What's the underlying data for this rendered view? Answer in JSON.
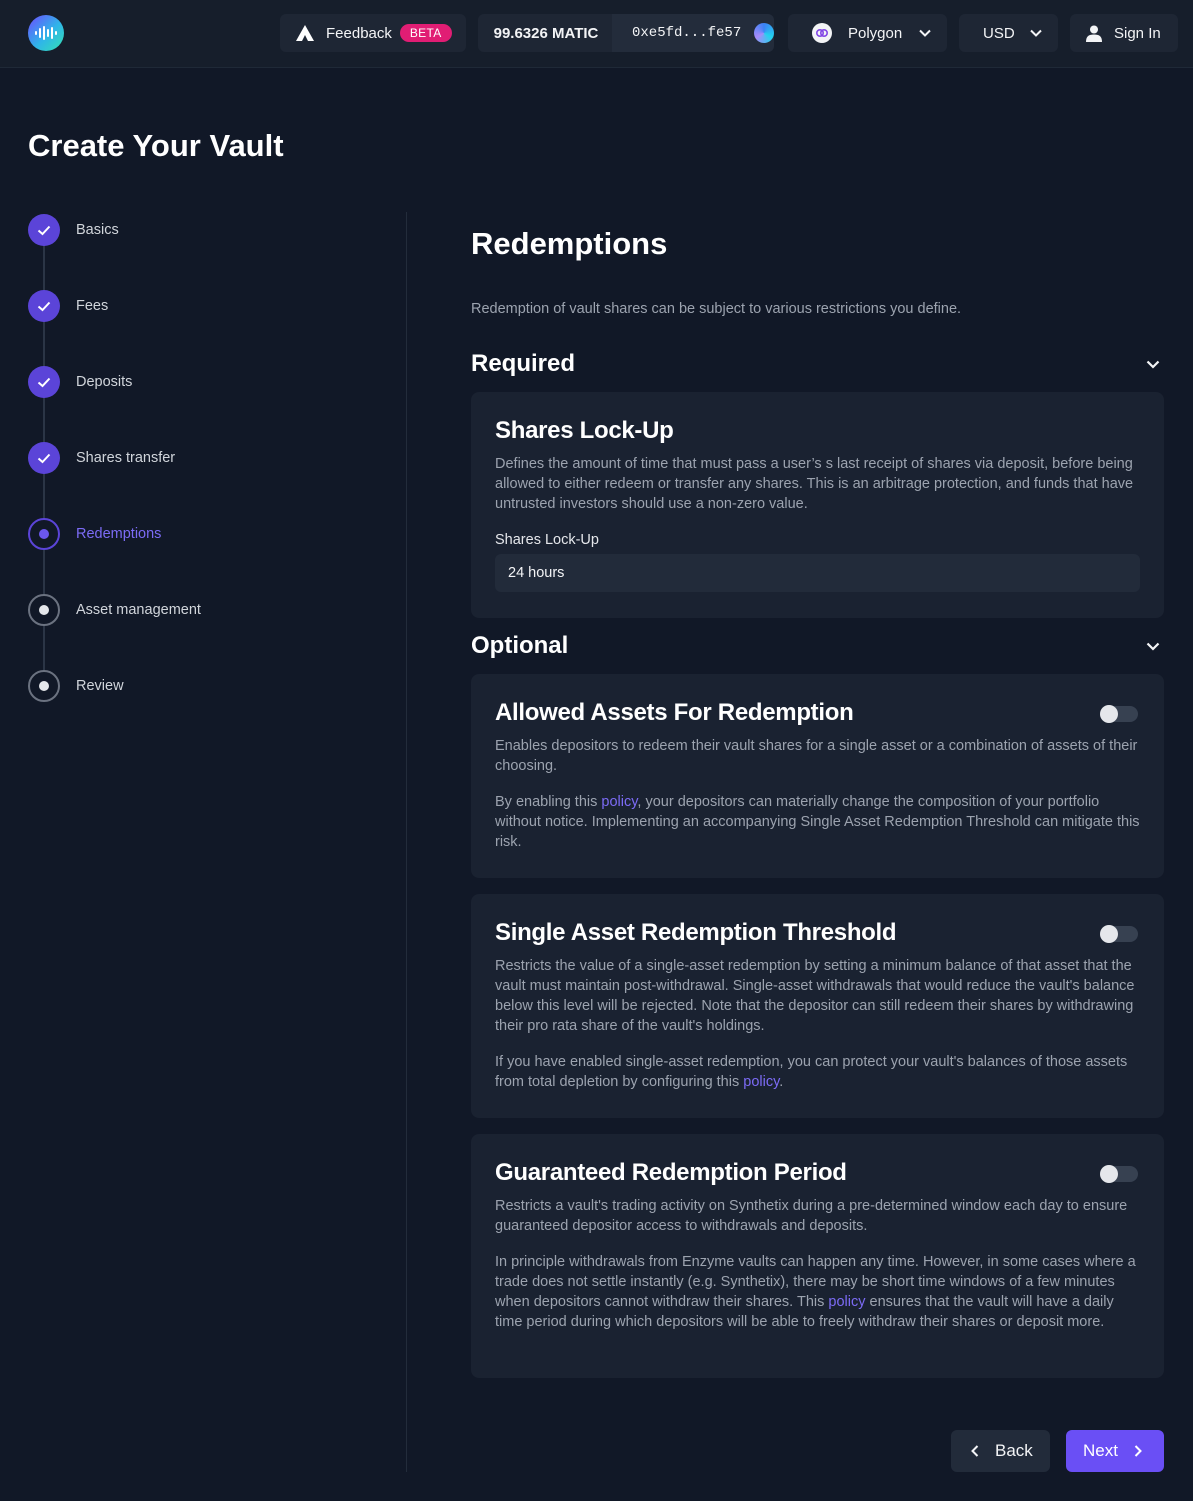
{
  "header": {
    "feedback_label": "Feedback",
    "feedback_badge": "BETA",
    "balance": "99.6326 MATIC",
    "address": "0xe5fd...fe57",
    "network": "Polygon",
    "currency": "USD",
    "signin_label": "Sign In"
  },
  "page_title": "Create Your Vault",
  "steps": [
    {
      "label": "Basics",
      "state": "done"
    },
    {
      "label": "Fees",
      "state": "done"
    },
    {
      "label": "Deposits",
      "state": "done"
    },
    {
      "label": "Shares transfer",
      "state": "done"
    },
    {
      "label": "Redemptions",
      "state": "current"
    },
    {
      "label": "Asset management",
      "state": "todo"
    },
    {
      "label": "Review",
      "state": "todo"
    }
  ],
  "main": {
    "title": "Redemptions",
    "description": "Redemption of vault shares can be subject to various restrictions you define.",
    "required": {
      "heading": "Required",
      "lockup": {
        "title": "Shares Lock-Up",
        "text": "Defines the amount of time that must pass a user’s s last receipt of shares via deposit, before being allowed to either redeem or transfer any shares. This is an arbitrage protection, and funds that have untrusted investors should use a non-zero value.",
        "field_label": "Shares Lock-Up",
        "field_value": "24 hours"
      }
    },
    "optional": {
      "heading": "Optional",
      "allowed_assets": {
        "title": "Allowed Assets For Redemption",
        "text1": "Enables depositors to redeem their vault shares for a single asset or a combination of assets of their choosing.",
        "text2_pre": "By enabling this ",
        "link": "policy",
        "text2_post": ", your depositors can materially change the composition of your portfolio without notice. Implementing an accompanying Single Asset Redemption Threshold can mitigate this risk.",
        "enabled": false
      },
      "single_asset": {
        "title": "Single Asset Redemption Threshold",
        "text1": "Restricts the value of a single-asset redemption by setting a minimum balance of that asset that the vault must maintain post-withdrawal. Single-asset withdrawals that would reduce the vault's balance below this level will be rejected. Note that the depositor can still redeem their shares by withdrawing their pro rata share of the vault's holdings.",
        "text2_pre": "If you have enabled single-asset redemption, you can protect your vault's balances of those assets from total depletion by configuring this ",
        "link": "policy",
        "text2_post": ".",
        "enabled": false
      },
      "guaranteed": {
        "title": "Guaranteed Redemption Period",
        "text1": "Restricts a vault's trading activity on Synthetix during a pre-determined window each day to ensure guaranteed depositor access to withdrawals and deposits.",
        "text2_pre": "In principle withdrawals from Enzyme vaults can happen any time. However, in some cases where a trade does not settle instantly (e.g. Synthetix), there may be short time windows of a few minutes when depositors cannot withdraw their shares. This ",
        "link": "policy",
        "text2_post": " ensures that the vault will have a daily time period during which depositors will be able to freely withdraw their shares or deposit more.",
        "enabled": false
      }
    }
  },
  "footer": {
    "back_label": "Back",
    "next_label": "Next"
  },
  "colors": {
    "background": "#111827",
    "accent": "#6a4ff5",
    "badge": "#e11d74",
    "card": "#1a2231"
  }
}
